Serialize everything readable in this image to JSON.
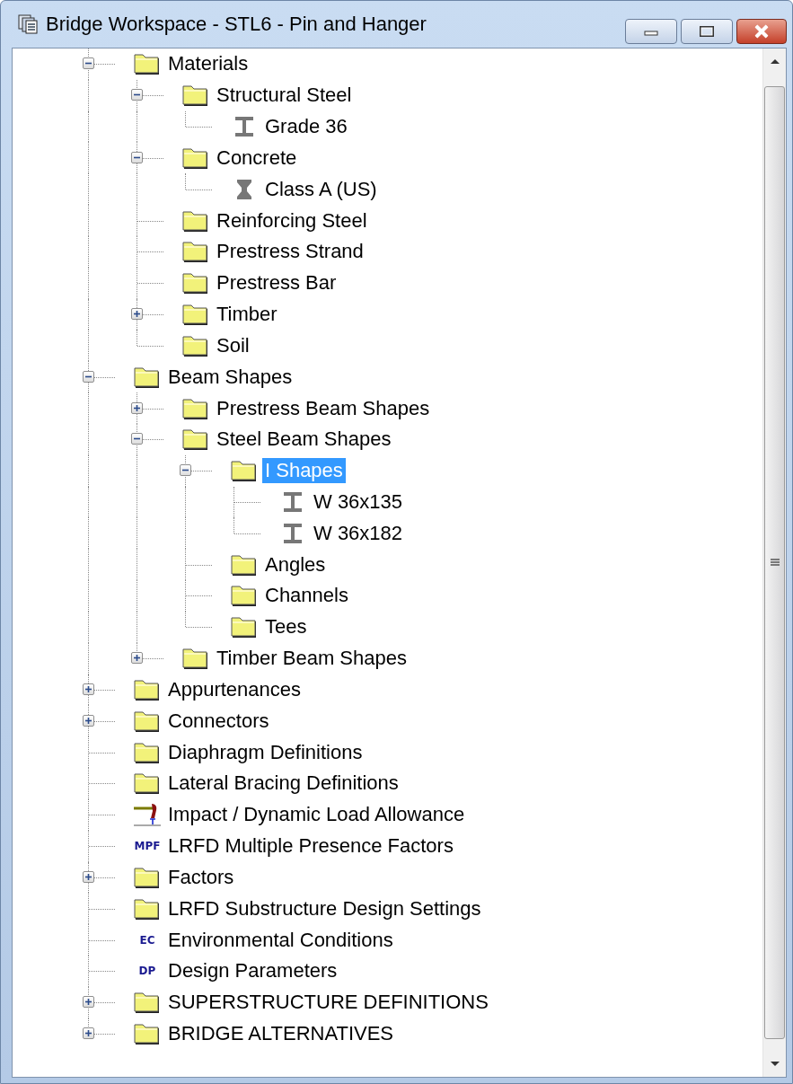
{
  "window": {
    "title": "Bridge Workspace - STL6 - Pin and Hanger"
  },
  "tree": [
    {
      "label": "Materials",
      "kind": "folder",
      "selected": false,
      "expanded": true,
      "children": [
        {
          "label": "Structural Steel",
          "kind": "folder",
          "selected": false,
          "expanded": true,
          "children": [
            {
              "label": "Grade 36",
              "kind": "steel",
              "selected": false
            }
          ]
        },
        {
          "label": "Concrete",
          "kind": "folder",
          "selected": false,
          "expanded": true,
          "children": [
            {
              "label": "Class A (US)",
              "kind": "concrete",
              "selected": false
            }
          ]
        },
        {
          "label": "Reinforcing Steel",
          "kind": "folder",
          "selected": false
        },
        {
          "label": "Prestress Strand",
          "kind": "folder",
          "selected": false
        },
        {
          "label": "Prestress Bar",
          "kind": "folder",
          "selected": false
        },
        {
          "label": "Timber",
          "kind": "folder",
          "selected": false,
          "expanded": false
        },
        {
          "label": "Soil",
          "kind": "folder",
          "selected": false
        }
      ]
    },
    {
      "label": "Beam Shapes",
      "kind": "folder",
      "selected": false,
      "expanded": true,
      "children": [
        {
          "label": "Prestress Beam Shapes",
          "kind": "folder",
          "selected": false,
          "expanded": false
        },
        {
          "label": "Steel Beam Shapes",
          "kind": "folder",
          "selected": false,
          "expanded": true,
          "children": [
            {
              "label": "I Shapes",
              "kind": "folder",
              "selected": true,
              "expanded": true,
              "children": [
                {
                  "label": "W 36x135",
                  "kind": "steel",
                  "selected": false
                },
                {
                  "label": "W 36x182",
                  "kind": "steel",
                  "selected": false
                }
              ]
            },
            {
              "label": "Angles",
              "kind": "folder",
              "selected": false
            },
            {
              "label": "Channels",
              "kind": "folder",
              "selected": false
            },
            {
              "label": "Tees",
              "kind": "folder",
              "selected": false
            }
          ]
        },
        {
          "label": "Timber Beam Shapes",
          "kind": "folder",
          "selected": false,
          "expanded": false
        }
      ]
    },
    {
      "label": "Appurtenances",
      "kind": "folder",
      "selected": false,
      "expanded": false
    },
    {
      "label": "Connectors",
      "kind": "folder",
      "selected": false,
      "expanded": false
    },
    {
      "label": "Diaphragm Definitions",
      "kind": "folder",
      "selected": false
    },
    {
      "label": "Lateral Bracing Definitions",
      "kind": "folder",
      "selected": false
    },
    {
      "label": "Impact / Dynamic Load Allowance",
      "kind": "load",
      "selected": false
    },
    {
      "label": "LRFD Multiple Presence Factors",
      "kind": "badge",
      "badge": "MPF",
      "selected": false
    },
    {
      "label": "Factors",
      "kind": "folder",
      "selected": false,
      "expanded": false
    },
    {
      "label": "LRFD Substructure Design Settings",
      "kind": "folder",
      "selected": false
    },
    {
      "label": "Environmental Conditions",
      "kind": "badge",
      "badge": "EC",
      "selected": false
    },
    {
      "label": "Design Parameters",
      "kind": "badge",
      "badge": "DP",
      "selected": false
    },
    {
      "label": "SUPERSTRUCTURE DEFINITIONS",
      "kind": "folder",
      "selected": false,
      "expanded": false
    },
    {
      "label": "BRIDGE ALTERNATIVES",
      "kind": "folder",
      "selected": false,
      "expanded": false
    }
  ]
}
